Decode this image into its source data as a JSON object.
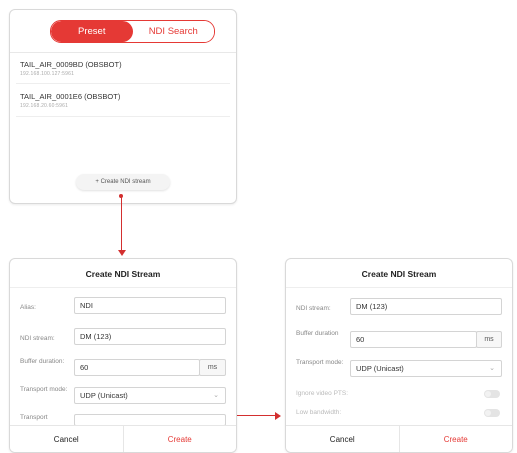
{
  "device_list_panel": {
    "tabs": {
      "preset": "Preset",
      "ndi_search": "NDI Search"
    },
    "devices": [
      {
        "name": "TAIL_AIR_0009BD (OBSBOT)",
        "ip": "192.168.100.127:5961"
      },
      {
        "name": "TAIL_AIR_0001E6 (OBSBOT)",
        "ip": "192.168.20.60:5961"
      }
    ],
    "create_button": "+  Create NDI stream"
  },
  "dialog_left": {
    "title": "Create NDI Stream",
    "alias_label": "Alias:",
    "alias_value": "NDI",
    "ndi_stream_label": "NDI stream:",
    "ndi_stream_value": "DM (123)",
    "buffer_label": "Buffer duration:",
    "buffer_value": "60",
    "buffer_unit": "ms",
    "transport_label": "Transport mode:",
    "transport_value": "UDP (Unicast)",
    "extra_label": "Transport",
    "cancel": "Cancel",
    "create": "Create"
  },
  "dialog_right": {
    "title": "Create NDI Stream",
    "ndi_stream_label": "NDI stream:",
    "ndi_stream_value": "DM (123)",
    "buffer_label": "Buffer duration",
    "buffer_value": "60",
    "buffer_unit": "ms",
    "transport_label": "Transport mode:",
    "transport_value": "UDP (Unicast)",
    "ignore_pts_label": "Ignore video PTS:",
    "ignore_pts_on": false,
    "low_bandwidth_label": "Low bandwidth:",
    "low_bandwidth_on": false,
    "cancel": "Cancel",
    "create": "Create"
  },
  "colors": {
    "accent": "#e53935",
    "connector": "#d32f2f"
  }
}
